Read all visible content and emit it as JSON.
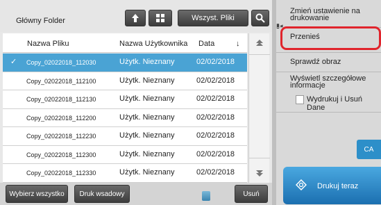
{
  "toolbar": {
    "folder": "Główny Folder",
    "all_files": "Wszyst. Pliki",
    "up_icon": "up-arrow-icon",
    "grid_icon": "grid-icon",
    "search_icon": "search-icon"
  },
  "table": {
    "headers": {
      "name": "Nazwa Pliku",
      "user": "Nazwa Użytkownika",
      "date": "Data",
      "sort": "↓"
    },
    "rows": [
      {
        "name": "Copy_02022018_112030",
        "user": "Użytk. Nieznany",
        "date": "02/02/2018",
        "selected": true
      },
      {
        "name": "Copy_02022018_112100",
        "user": "Użytk. Nieznany",
        "date": "02/02/2018",
        "selected": false
      },
      {
        "name": "Copy_02022018_112130",
        "user": "Użytk. Nieznany",
        "date": "02/02/2018",
        "selected": false
      },
      {
        "name": "Copy_02022018_112200",
        "user": "Użytk. Nieznany",
        "date": "02/02/2018",
        "selected": false
      },
      {
        "name": "Copy_02022018_112230",
        "user": "Użytk. Nieznany",
        "date": "02/02/2018",
        "selected": false
      },
      {
        "name": "Copy_02022018_112300",
        "user": "Użytk. Nieznany",
        "date": "02/02/2018",
        "selected": false
      },
      {
        "name": "Copy_02022018_112330",
        "user": "Użytk. Nieznany",
        "date": "02/02/2018",
        "selected": false
      }
    ]
  },
  "bottom": {
    "select_all": "Wybierz wszystko",
    "batch_print": "Druk wsadowy",
    "delete": "Usuń"
  },
  "sidebar": {
    "change_settings": "Zmień ustawienie na drukowanie",
    "move": "Przenieś",
    "check_image": "Sprawdź obraz",
    "show_details": "Wyświetl szczegółowe informacje",
    "print_and_delete": "Wydrukuj i Usuń Dane",
    "ca": "CA",
    "print_now": "Drukuj teraz"
  },
  "colors": {
    "selected_row": "#4aa3d4",
    "highlight": "#e0242c",
    "print_button": "#1b6fb0"
  }
}
